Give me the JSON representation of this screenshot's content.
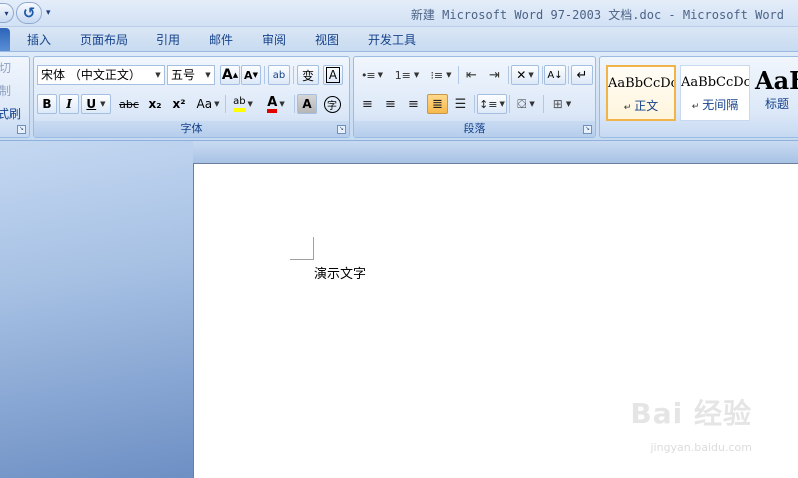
{
  "window": {
    "title": "新建 Microsoft Word 97-2003 文档.doc - Microsoft Word"
  },
  "quick_access": {
    "undo_more": "▾",
    "redo_icon": "redo-icon",
    "customize": "▾"
  },
  "tabs": [
    {
      "label": "插入"
    },
    {
      "label": "页面布局"
    },
    {
      "label": "引用"
    },
    {
      "label": "邮件"
    },
    {
      "label": "审阅"
    },
    {
      "label": "视图"
    },
    {
      "label": "开发工具"
    }
  ],
  "clipboard": {
    "cut": "切",
    "copy": "制",
    "format_painter": "式刷"
  },
  "font_group": {
    "label": "字体",
    "font_name": "宋体 （中文正文）",
    "font_size": "五号",
    "grow": "A",
    "shrink": "A",
    "clear_format": "ab",
    "phonetic": "变",
    "char_border": "A",
    "bold": "B",
    "italic": "I",
    "underline": "U",
    "strike": "abc",
    "subscript": "x₂",
    "superscript": "x²",
    "change_case": "Aa",
    "highlight": "ab",
    "font_color": "A",
    "char_shading": "A",
    "enclose": "字"
  },
  "paragraph_group": {
    "label": "段落"
  },
  "styles": [
    {
      "sample": "AaBbCcDc",
      "name": "正文",
      "selected": true
    },
    {
      "sample": "AaBbCcDc",
      "name": "无间隔",
      "selected": false
    },
    {
      "sample": "AaB",
      "name": "标题",
      "selected": false
    }
  ],
  "document": {
    "text": "演示文字"
  },
  "watermark": {
    "brand": "Bai 经验",
    "url": "jingyan.baidu.com"
  },
  "colors": {
    "ribbon_text": "#15428b",
    "highlight_yellow": "#ffff00",
    "font_red": "#e00000",
    "selected_style": "#f0b44a"
  }
}
